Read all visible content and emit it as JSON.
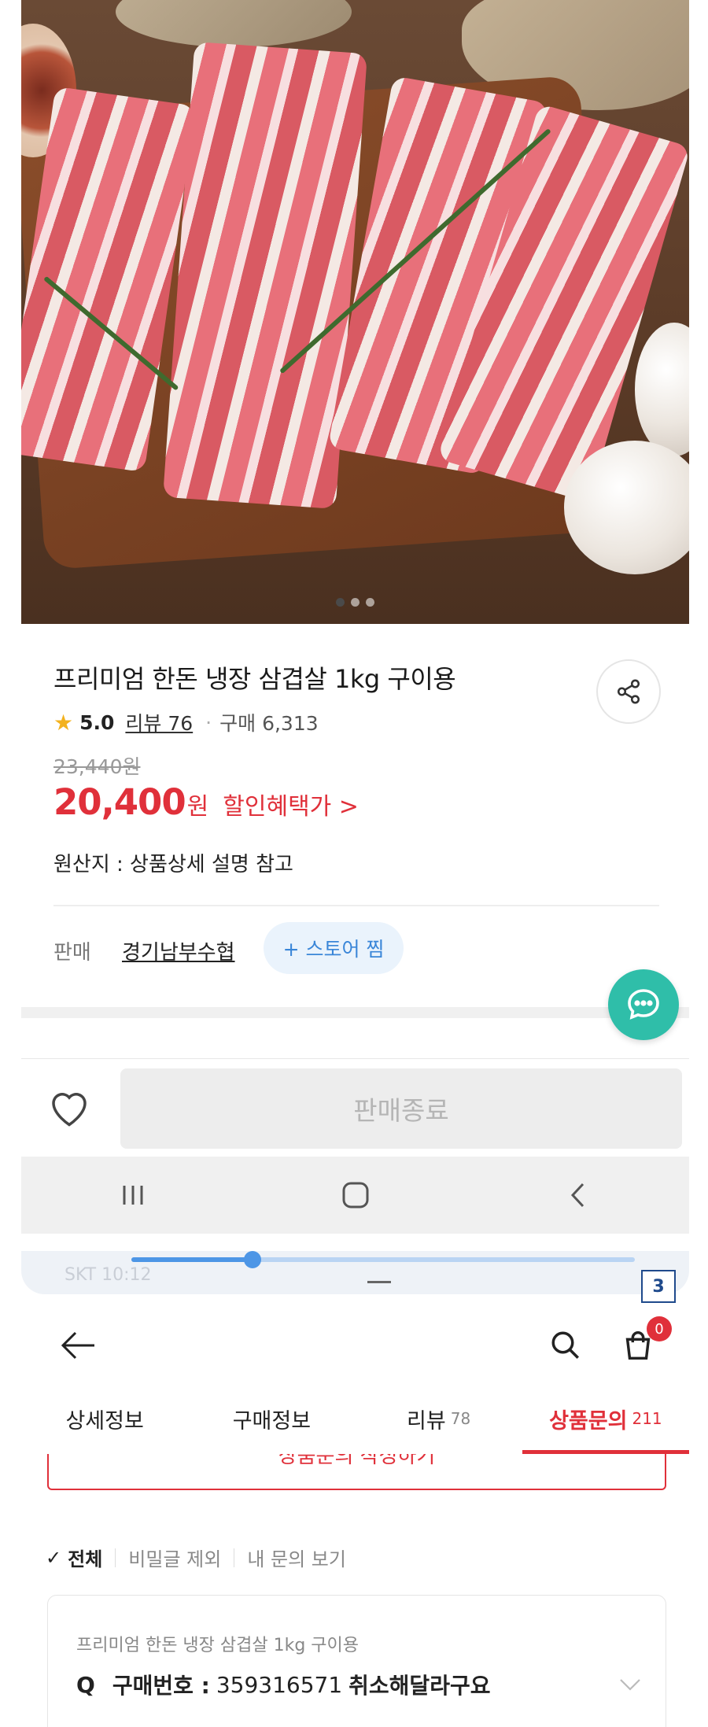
{
  "product": {
    "title": "프리미엄 한돈 냉장 삼겹살 1kg 구이용",
    "rating": "5.0",
    "review_link": "리뷰 76",
    "purchase_count": "구매 6,313",
    "original_price": "23,440원",
    "sale_price": "20,400",
    "won": "원",
    "discount_link": "할인혜택가 >",
    "origin": "원산지 : 상품상세 설명 참고",
    "seller_label": "판매",
    "seller_name": "경기남부수협",
    "follow_button": "+ 스토어 찜",
    "sold_out_button": "판매종료"
  },
  "carousel": {
    "total": 3,
    "active_index": 0
  },
  "status_bar": {
    "text": "SKT 10:12",
    "playback_progress": 0.24
  },
  "annotation_badge": "3",
  "cart_count": "0",
  "tabs": [
    {
      "label": "상세정보",
      "count": ""
    },
    {
      "label": "구매정보",
      "count": ""
    },
    {
      "label": "리뷰",
      "count": "78"
    },
    {
      "label": "상품문의",
      "count": "211"
    }
  ],
  "qa": {
    "write_button": "상품문의 작성하기",
    "filters": [
      "전체",
      "비밀글 제외",
      "내 문의 보기"
    ],
    "card": {
      "product_name": "프리미엄 한돈 냉장 삼겹살 1kg 구이용",
      "q_mark": "Q",
      "label": "구매번호 :",
      "order_number": "359316571",
      "message": "취소해달라구요"
    }
  },
  "colors": {
    "accent_red": "#e0303a",
    "chat_teal": "#2fbea9",
    "follow_blue": "#3a86d8",
    "star": "#f3b21e"
  }
}
